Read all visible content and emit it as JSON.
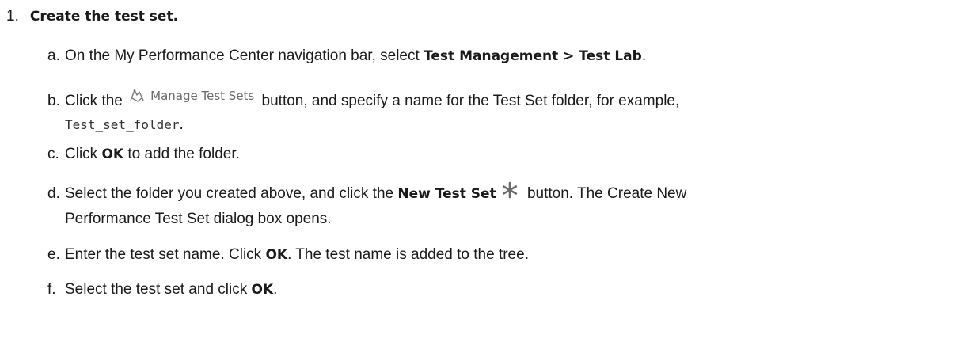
{
  "step": {
    "number": "1.",
    "title": "Create the test set."
  },
  "substeps": {
    "a": {
      "letter": "a.",
      "text1": "On the My Performance Center navigation bar, select ",
      "bold": "Test Management > Test Lab",
      "text2": "."
    },
    "b": {
      "letter": "b.",
      "text1": "Click the ",
      "button_label": "Manage Test Sets",
      "text2": " button, and specify a name for the Test Set folder, for example,",
      "code": "Test_set_folder",
      "text3": "."
    },
    "c": {
      "letter": "c.",
      "text1": "Click ",
      "bold": "OK",
      "text2": " to add the folder."
    },
    "d": {
      "letter": "d.",
      "text1": "Select the folder you created above, and click the ",
      "bold": "New Test Set",
      "text2": " button. The Create New",
      "text3": "Performance Test Set dialog box opens."
    },
    "e": {
      "letter": "e.",
      "text1": "Enter the test set name. Click ",
      "bold": "OK",
      "text2": ". The test name is added to the tree."
    },
    "f": {
      "letter": "f.",
      "text1": "Select the test set and click ",
      "bold": "OK",
      "text2": "."
    }
  },
  "icons": {
    "manage": "manage-test-sets-icon",
    "new": "new-test-set-asterisk-icon"
  }
}
